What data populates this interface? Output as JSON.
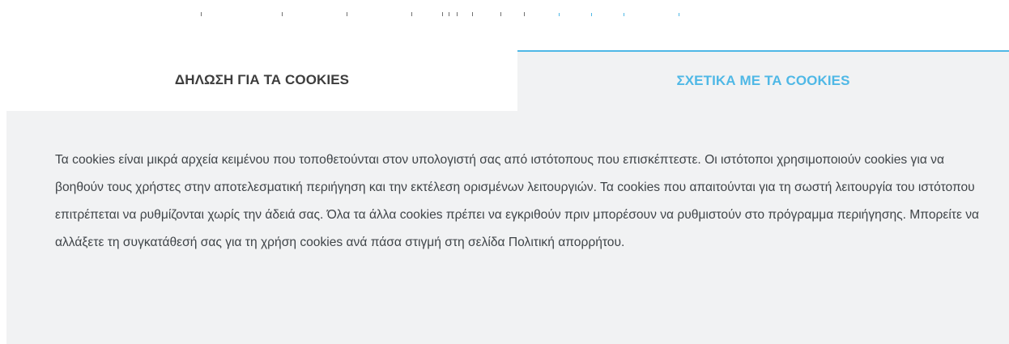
{
  "colors": {
    "accent": "#4fb8e6",
    "panel_background": "#f1f2f3",
    "text": "#3f4448",
    "tab_inactive_text": "#3d3d3d"
  },
  "tabs": [
    {
      "label": "ΔΗΛΩΣΗ ΓΙΑ ΤΑ COOKIES",
      "selected": false
    },
    {
      "label": "ΣΧΕΤΙΚΑ ΜΕ ΤΑ COOKIES",
      "selected": true
    }
  ],
  "panel": {
    "text": "Τα cookies είναι μικρά αρχεία κειμένου που τοποθετούνται στον υπολογιστή σας από ιστότοπους που επισκέπτεστε. Οι ιστότοποι χρησιμοποιούν cookies για να βοηθούν τους χρήστες στην αποτελεσματική περιήγηση και την εκτέλεση ορισμένων λειτουργιών. Τα cookies που απαιτούνται για τη σωστή λειτουργία του ιστότοπου επιτρέπεται να ρυθμίζονται χωρίς την άδειά σας. Όλα τα άλλα cookies πρέπει να εγκριθούν πριν μπορέσουν να ρυθμιστούν στο πρόγραμμα περιήγησης. Μπορείτε να αλλάξετε τη συγκατάθεσή σας για τη χρήση cookies ανά πάσα στιγμή στη σελίδα Πολιτική απορρήτου."
  }
}
